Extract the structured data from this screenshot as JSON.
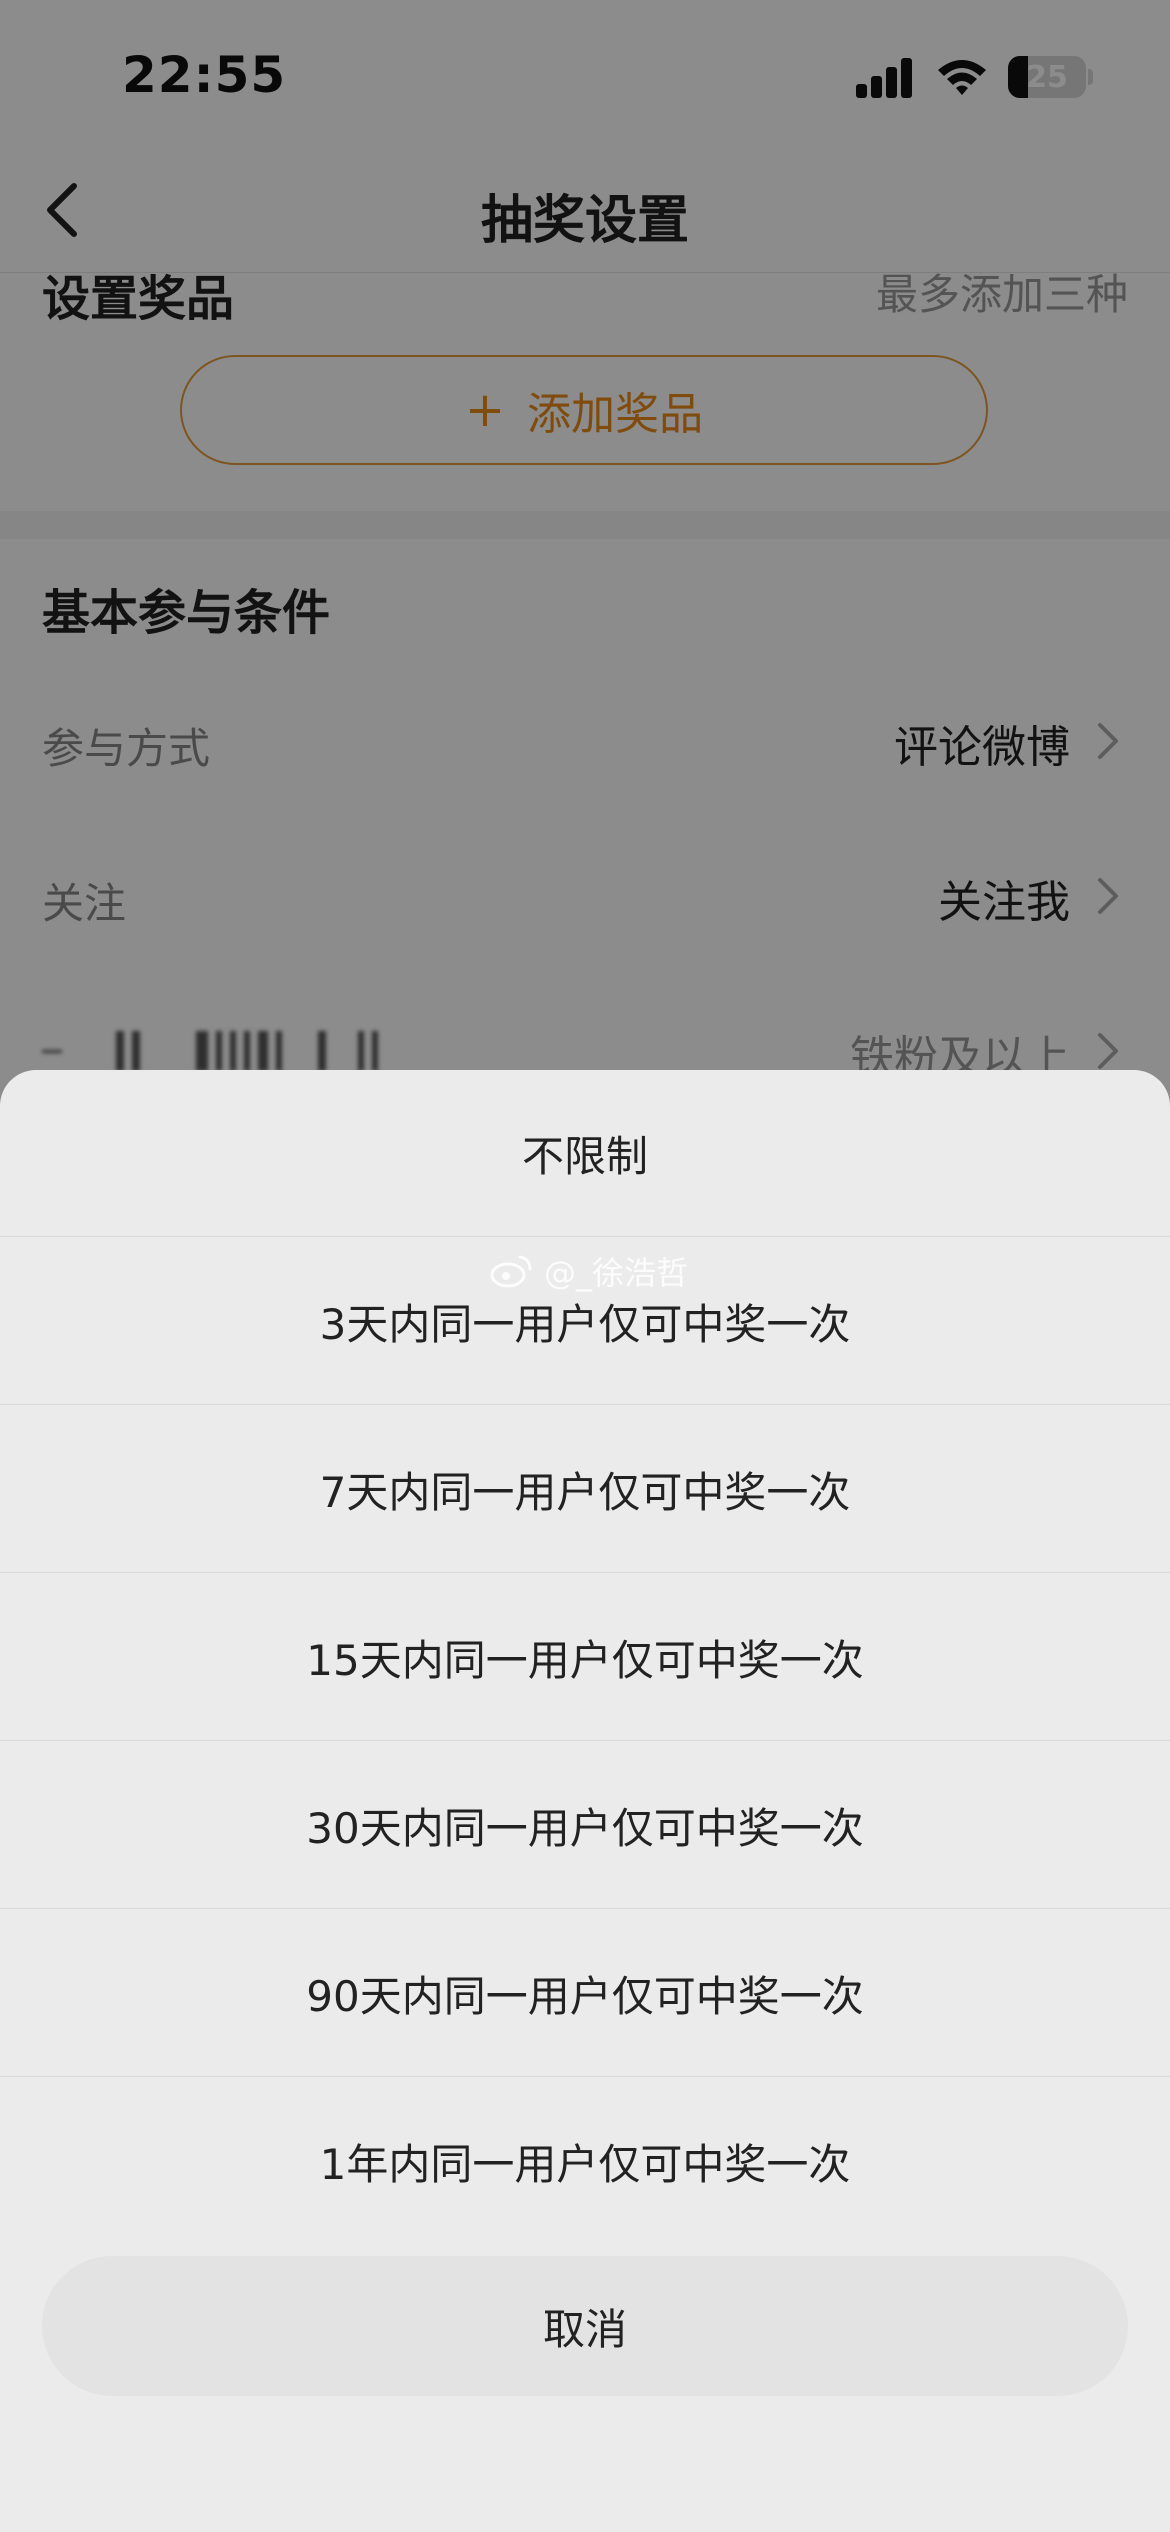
{
  "status_bar": {
    "time": "22:55",
    "battery": "25",
    "battery_level": 0.25
  },
  "nav": {
    "title": "抽奖设置"
  },
  "prize_section": {
    "heading": "设置奖品",
    "hint": "最多添加三种",
    "add_button": "添加奖品"
  },
  "conditions": {
    "heading": "基本参与条件",
    "rows": [
      {
        "label": "参与方式",
        "value": "评论微博"
      },
      {
        "label": "关注",
        "value": "关注我"
      },
      {
        "label": "",
        "value": "铁粉及以上"
      }
    ]
  },
  "sheet": {
    "options": [
      "不限制",
      "3天内同一用户仅可中奖一次",
      "7天内同一用户仅可中奖一次",
      "15天内同一用户仅可中奖一次",
      "30天内同一用户仅可中奖一次",
      "90天内同一用户仅可中奖一次",
      "1年内同一用户仅可中奖一次"
    ],
    "cancel": "取消"
  },
  "watermark": "@_徐浩哲",
  "colors": {
    "accent": "#e88a1a",
    "overlay": "rgba(0,0,0,0.45)"
  }
}
